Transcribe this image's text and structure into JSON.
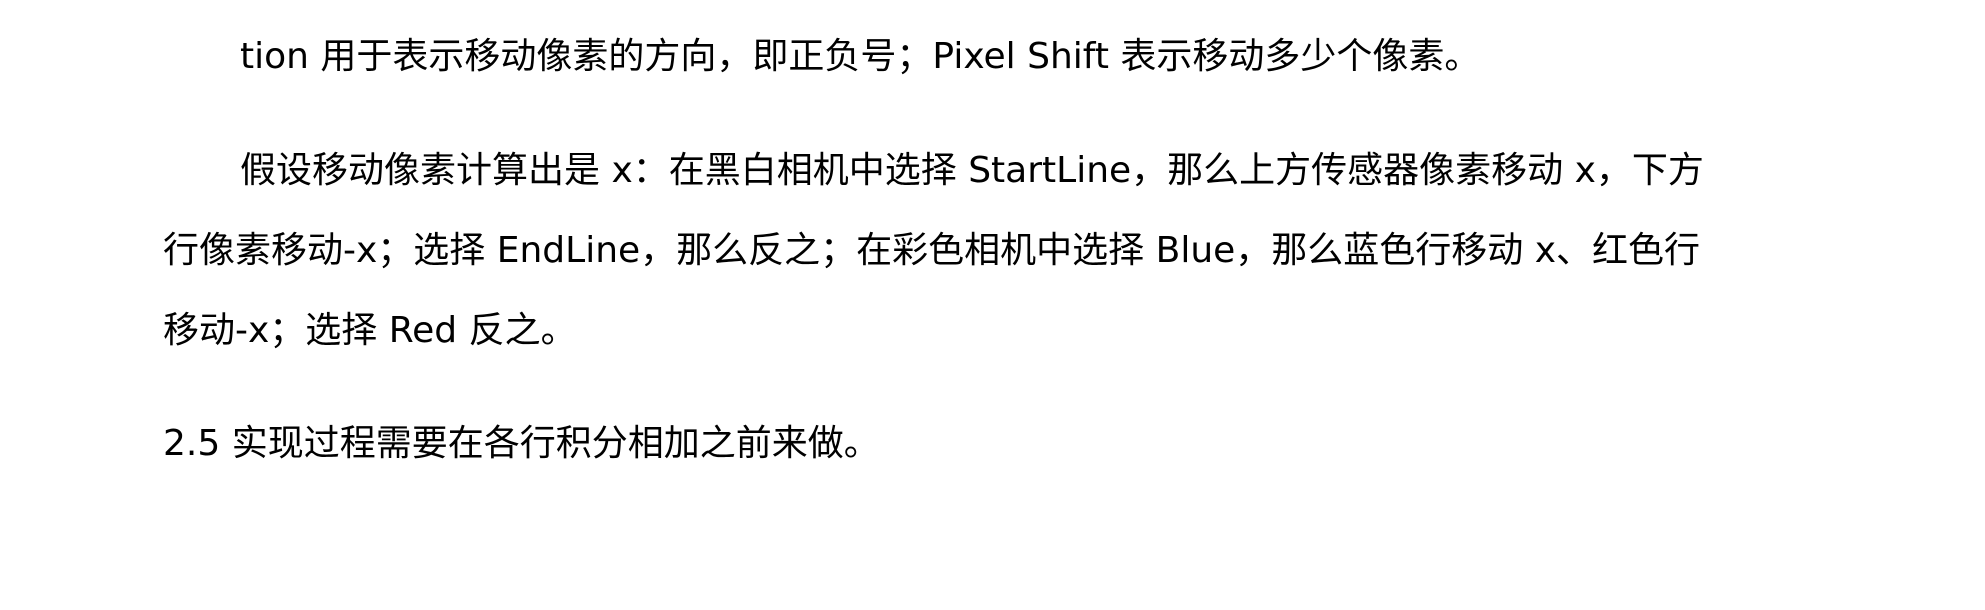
{
  "document": {
    "lines": [
      "tion 用于表示移动像素的方向，即正负号；Pixel  Shift 表示移动多少个像素。",
      "假设移动像素计算出是 x：在黑白相机中选择 StartLine，那么上方传感器像素移动 x，下方",
      "行像素移动-x；选择 EndLine，那么反之；在彩色相机中选择 Blue，那么蓝色行移动 x、红色行",
      "移动-x；选择 Red 反之。",
      "2.5  实现过程需要在各行积分相加之前来做。"
    ]
  }
}
